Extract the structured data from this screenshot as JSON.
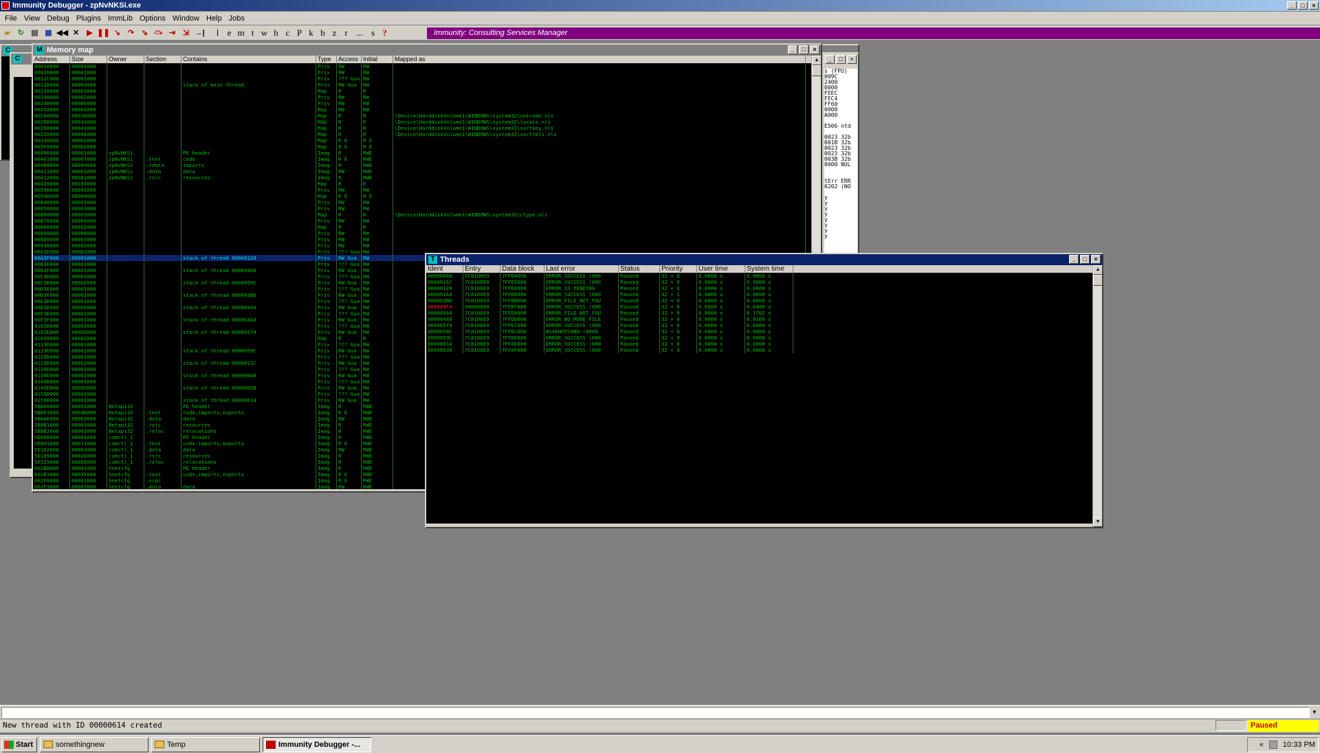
{
  "app": {
    "title": "Immunity Debugger - zpNvNKSi.exe"
  },
  "menu": [
    "File",
    "View",
    "Debug",
    "Plugins",
    "ImmLib",
    "Options",
    "Window",
    "Help",
    "Jobs"
  ],
  "toolbar": {
    "letters": [
      "l",
      "e",
      "m",
      "t",
      "w",
      "h",
      "c",
      "P",
      "k",
      "b",
      "z",
      "r",
      "...",
      "s",
      "?"
    ],
    "banner": "Immunity: Consulting Services Manager"
  },
  "memory_map": {
    "title": "Memory map",
    "columns": [
      "Address",
      "Size",
      "Owner",
      "Section",
      "Contains",
      "Type",
      "Access",
      "Initial",
      "Mapped as"
    ],
    "rows": [
      [
        "00010000",
        "00001000",
        "",
        "",
        "",
        "Priv",
        "RW",
        "RW",
        ""
      ],
      [
        "00020000",
        "00001000",
        "",
        "",
        "",
        "Priv",
        "RW",
        "RW",
        ""
      ],
      [
        "0012C000",
        "00001000",
        "",
        "",
        "",
        "Priv",
        "??? Gua",
        "RW",
        ""
      ],
      [
        "0012D000",
        "00003000",
        "",
        "",
        "stack of main thread",
        "Priv",
        "RW Gua",
        "RW",
        ""
      ],
      [
        "00130000",
        "00003000",
        "",
        "",
        "",
        "Map",
        "R",
        "R",
        ""
      ],
      [
        "00140000",
        "00002000",
        "",
        "",
        "",
        "Priv",
        "RW",
        "RW",
        ""
      ],
      [
        "00240000",
        "00006000",
        "",
        "",
        "",
        "Priv",
        "RW",
        "RW",
        ""
      ],
      [
        "00250000",
        "00003000",
        "",
        "",
        "",
        "Map",
        "RW",
        "RW",
        ""
      ],
      [
        "00260000",
        "00016000",
        "",
        "",
        "",
        "Map",
        "R",
        "R",
        "\\Device\\HarddiskVolume1\\WINDOWS\\system32\\unicode.nls"
      ],
      [
        "00280000",
        "00041000",
        "",
        "",
        "",
        "Map",
        "R",
        "R",
        "\\Device\\HarddiskVolume1\\WINDOWS\\system32\\locale.nls"
      ],
      [
        "002D0000",
        "00041000",
        "",
        "",
        "",
        "Map",
        "R",
        "R",
        "\\Device\\HarddiskVolume1\\WINDOWS\\system32\\sortkey.nls"
      ],
      [
        "00320000",
        "00006000",
        "",
        "",
        "",
        "Map",
        "R",
        "R",
        "\\Device\\HarddiskVolume1\\WINDOWS\\system32\\sorttbls.nls"
      ],
      [
        "00330000",
        "00002000",
        "",
        "",
        "",
        "Map",
        "R E",
        "R E",
        ""
      ],
      [
        "003F0000",
        "00002000",
        "",
        "",
        "",
        "Map",
        "R E",
        "R E",
        ""
      ],
      [
        "00400000",
        "00001000",
        "zpNvNKSi",
        "",
        "PE header",
        "Imag",
        "R",
        "RWE",
        ""
      ],
      [
        "00401000",
        "00007000",
        "zpNvNKSi",
        ".text",
        "code",
        "Imag",
        "R E",
        "RWE",
        ""
      ],
      [
        "00408000",
        "00009000",
        "zpNvNKSi",
        ".rdata",
        "imports",
        "Imag",
        "R",
        "RWE",
        ""
      ],
      [
        "00411000",
        "00001000",
        "zpNvNKSi",
        ".data",
        "data",
        "Imag",
        "RW",
        "RWE",
        ""
      ],
      [
        "00412000",
        "00001000",
        "zpNvNKSi",
        ".rsrc",
        "resources",
        "Imag",
        "R",
        "RWE",
        ""
      ],
      [
        "00420000",
        "00103000",
        "",
        "",
        "",
        "Map",
        "R",
        "R",
        ""
      ],
      [
        "00530000",
        "00001000",
        "",
        "",
        "",
        "Priv",
        "RW",
        "RW",
        ""
      ],
      [
        "00540000",
        "00004000",
        "",
        "",
        "",
        "Map",
        "R E",
        "R E",
        ""
      ],
      [
        "00840000",
        "00001000",
        "",
        "",
        "",
        "Priv",
        "RW",
        "RW",
        ""
      ],
      [
        "00850000",
        "00003000",
        "",
        "",
        "",
        "Priv",
        "RW",
        "RW",
        ""
      ],
      [
        "00860000",
        "00003000",
        "",
        "",
        "",
        "Map",
        "R",
        "R",
        "\\Device\\HarddiskVolume1\\WINDOWS\\system32\\ctype.nls"
      ],
      [
        "00870000",
        "00004000",
        "",
        "",
        "",
        "Priv",
        "RW",
        "RW",
        ""
      ],
      [
        "00880000",
        "00002000",
        "",
        "",
        "",
        "Map",
        "R",
        "R",
        ""
      ],
      [
        "00890000",
        "00008000",
        "",
        "",
        "",
        "Priv",
        "RW",
        "RW",
        ""
      ],
      [
        "008D0000",
        "00003000",
        "",
        "",
        "",
        "Priv",
        "RW",
        "RW",
        ""
      ],
      [
        "00930000",
        "00002000",
        "",
        "",
        "",
        "Priv",
        "RW",
        "RW",
        ""
      ],
      [
        "00A3E000",
        "00001000",
        "",
        "",
        "",
        "Priv",
        "??? Gua",
        "RW",
        ""
      ],
      [
        "00A3F000",
        "00001000",
        "",
        "",
        "stack of thread 00000128",
        "Priv",
        "RW Gua",
        "RW",
        ""
      ],
      [
        "00B3E000",
        "00001000",
        "",
        "",
        "",
        "Priv",
        "??? Gua",
        "RW",
        ""
      ],
      [
        "00B3F000",
        "00001000",
        "",
        "",
        "stack of thread 000004A0",
        "Priv",
        "RW Gua",
        "RW",
        ""
      ],
      [
        "00C3D000",
        "00001000",
        "",
        "",
        "",
        "Priv",
        "??? Gua",
        "RW",
        ""
      ],
      [
        "00C3E000",
        "00002000",
        "",
        "",
        "stack of thread 0000059C",
        "Priv",
        "RW Gua",
        "RW",
        ""
      ],
      [
        "00D3E000",
        "00001000",
        "",
        "",
        "",
        "Priv",
        "??? Gua",
        "RW",
        ""
      ],
      [
        "00D3F000",
        "00001000",
        "",
        "",
        "stack of thread 000003B0",
        "Priv",
        "RW Gua",
        "RW",
        ""
      ],
      [
        "00E3D000",
        "00001000",
        "",
        "",
        "",
        "Priv",
        "??? Gua",
        "RW",
        ""
      ],
      [
        "00E3E000",
        "00002000",
        "",
        "",
        "stack of thread 00000444",
        "Priv",
        "RW Gua",
        "RW",
        ""
      ],
      [
        "00F3E000",
        "00001000",
        "",
        "",
        "",
        "Priv",
        "??? Gua",
        "RW",
        ""
      ],
      [
        "00F3F000",
        "00001000",
        "",
        "",
        "stack of thread 000003A4",
        "Priv",
        "RW Gua",
        "RW",
        ""
      ],
      [
        "0103D000",
        "00001000",
        "",
        "",
        "",
        "Priv",
        "??? Gua",
        "RW",
        ""
      ],
      [
        "0103E000",
        "00002000",
        "",
        "",
        "stack of thread 00000574",
        "Priv",
        "RW Gua",
        "RW",
        ""
      ],
      [
        "01050000",
        "00002000",
        "",
        "",
        "",
        "Map",
        "R",
        "R",
        ""
      ],
      [
        "0119D000",
        "00001000",
        "",
        "",
        "",
        "Priv",
        "??? Gua",
        "RW",
        ""
      ],
      [
        "0119E000",
        "00002000",
        "",
        "",
        "stack of thread 0000059C",
        "Priv",
        "RW Gua",
        "RW",
        ""
      ],
      [
        "0129D000",
        "00001000",
        "",
        "",
        "",
        "Priv",
        "??? Gua",
        "RW",
        ""
      ],
      [
        "0129E000",
        "00002000",
        "",
        "",
        "stack of thread 0000011C",
        "Priv",
        "RW Gua",
        "RW",
        ""
      ],
      [
        "0139D000",
        "00001000",
        "",
        "",
        "",
        "Priv",
        "??? Gua",
        "RW",
        ""
      ],
      [
        "0139E000",
        "00002000",
        "",
        "",
        "stack of thread 000000A8",
        "Priv",
        "RW Gua",
        "RW",
        ""
      ],
      [
        "0149D000",
        "00001000",
        "",
        "",
        "",
        "Priv",
        "??? Gua",
        "RW",
        ""
      ],
      [
        "0149E000",
        "00002000",
        "",
        "",
        "stack of thread 00000638",
        "Priv",
        "RW Gua",
        "RW",
        ""
      ],
      [
        "0159D000",
        "00001000",
        "",
        "",
        "",
        "Priv",
        "??? Gua",
        "RW",
        ""
      ],
      [
        "0159E000",
        "00002000",
        "",
        "",
        "stack of thread 00000614",
        "Priv",
        "RW Gua",
        "RW",
        ""
      ],
      [
        "5B860000",
        "00001000",
        "Netapi32",
        "",
        "PE header",
        "Imag",
        "R",
        "RWE",
        ""
      ],
      [
        "5B861000",
        "0004D000",
        "Netapi32",
        ".text",
        "code,imports,exports",
        "Imag",
        "R E",
        "RWE",
        ""
      ],
      [
        "5B8AE000",
        "00003000",
        "Netapi32",
        ".data",
        "data",
        "Imag",
        "RW",
        "RWE",
        ""
      ],
      [
        "5B8B1000",
        "00001000",
        "Netapi32",
        ".rsrc",
        "resources",
        "Imag",
        "R",
        "RWE",
        ""
      ],
      [
        "5B8B2000",
        "00003000",
        "Netapi32",
        ".reloc",
        "relocations",
        "Imag",
        "R",
        "RWE",
        ""
      ],
      [
        "5D090000",
        "00001000",
        "comctl_1",
        "",
        "PE header",
        "Imag",
        "R",
        "RWE",
        ""
      ],
      [
        "5D091000",
        "00071000",
        "comctl_1",
        ".text",
        "code,imports,exports",
        "Imag",
        "R E",
        "RWE",
        ""
      ],
      [
        "5D102000",
        "00003000",
        "comctl_1",
        ".data",
        "data",
        "Imag",
        "RW",
        "RWE",
        ""
      ],
      [
        "5D105000",
        "00020000",
        "comctl_1",
        ".rsrc",
        "resources",
        "Imag",
        "R",
        "RWE",
        ""
      ],
      [
        "5D125000",
        "00005000",
        "comctl_1",
        ".reloc",
        "relocations",
        "Imag",
        "R",
        "RWE",
        ""
      ],
      [
        "662B0000",
        "00001000",
        "hnetcfg",
        "",
        "PE header",
        "Imag",
        "R",
        "RWE",
        ""
      ],
      [
        "662B1000",
        "0003F000",
        "hnetcfg",
        ".text",
        "code,imports,exports",
        "Imag",
        "R E",
        "RWE",
        ""
      ],
      [
        "662F0000",
        "00001000",
        "hnetcfg",
        ".orpc",
        "",
        "Imag",
        "R E",
        "RWE",
        ""
      ],
      [
        "662F1000",
        "00002000",
        "hnetcfg",
        ".data",
        "data",
        "Imag",
        "RW",
        "RWE",
        ""
      ]
    ],
    "selected_row": 31
  },
  "threads": {
    "title": "Threads",
    "columns": [
      "Ident",
      "Entry",
      "Data block",
      "Last error",
      "Status",
      "Priority",
      "User time",
      "System time"
    ],
    "rows": [
      [
        "000000A8",
        "7C8106E9",
        "7FFD4000",
        "ERROR_SUCCESS (000",
        "Paused",
        "32 + 0",
        "0.0000 s",
        "0.0000 s"
      ],
      [
        "0000011C",
        "7C8106E9",
        "7FFD5000",
        "ERROR_SUCCESS (000",
        "Paused",
        "32 + 0",
        "0.0000 s",
        "0.0000 s"
      ],
      [
        "00000128",
        "7C8106E9",
        "7FFDE000",
        "ERROR_IO_PENDING",
        "Paused",
        "32 + 0",
        "0.0000 s",
        "0.0600 s"
      ],
      [
        "000003A4",
        "7C8106E9",
        "7FFD8000",
        "ERROR_SUCCESS (000",
        "Paused",
        "32 + 1",
        "0.0000 s",
        "0.0000 s"
      ],
      [
        "000003B0",
        "7C8106E9",
        "7FFDB000",
        "ERROR_FILE_NOT_FOU",
        "Paused",
        "32 + 0",
        "0.0000 s",
        "0.0000 s"
      ],
      [
        "000003F4",
        "00000000",
        "7FFDF000",
        "ERROR_SUCCESS (000",
        "Paused",
        "32 + 0",
        "0.0300 s",
        "0.0400 s"
      ],
      [
        "00000444",
        "7C8106E9",
        "7FFD9000",
        "ERROR_FILE_NOT_FOU",
        "Paused",
        "32 + 0",
        "0.0000 s",
        "0.1702 s"
      ],
      [
        "000004A0",
        "7C8106E9",
        "7FFDD000",
        "ERROR_NO_MORE_FILE",
        "Paused",
        "32 + 0",
        "0.0000 s",
        "0.0100 s"
      ],
      [
        "00000574",
        "7C8106E9",
        "7FFD7000",
        "ERROR_SUCCESS (000",
        "Paused",
        "32 + 0",
        "0.0000 s",
        "0.0000 s"
      ],
      [
        "0000058C",
        "7C8106E9",
        "7FFDC000",
        "WSAENOTCONN (0000",
        "Paused",
        "32 + 0",
        "0.0000 s",
        "0.0000 s"
      ],
      [
        "0000059C",
        "7C8106E9",
        "7FFD6000",
        "ERROR_SUCCESS (000",
        "Paused",
        "32 + 0",
        "0.0000 s",
        "0.0000 s"
      ],
      [
        "00000614",
        "7C8106E9",
        "7FFAE000",
        "ERROR_SUCCESS (000",
        "Paused",
        "32 + 0",
        "0.0000 s",
        "0.0000 s"
      ],
      [
        "00000638",
        "7C8106E9",
        "7FFAF000",
        "ERROR_SUCCESS (000",
        "Paused",
        "32 + 0",
        "0.0000 s",
        "0.0000 s"
      ]
    ],
    "highlight_row": 5
  },
  "cpu_side": [
    "s (FPU)",
    "009C",
    "2400",
    "0000",
    "FEEC",
    "FEC4",
    "FF60",
    "0000",
    "A000",
    "",
    "E506 ntd",
    "",
    "0023 32b",
    "001B 32b",
    "0023 32b",
    "0023 32b",
    "003B 32b",
    "0000 NUL",
    "",
    "",
    "tErr ERR",
    "0202 (NO",
    "",
    "y",
    "y",
    "y",
    "y",
    "y",
    "y",
    "y",
    "y"
  ],
  "status": {
    "message": "New thread with ID 00000614 created",
    "state": "Paused"
  },
  "taskbar": {
    "start": "Start",
    "tasks": [
      "somethingnew",
      "Temp",
      "Immunity Debugger -..."
    ],
    "clock": "10:33 PM",
    "tray_arrows": "«"
  }
}
